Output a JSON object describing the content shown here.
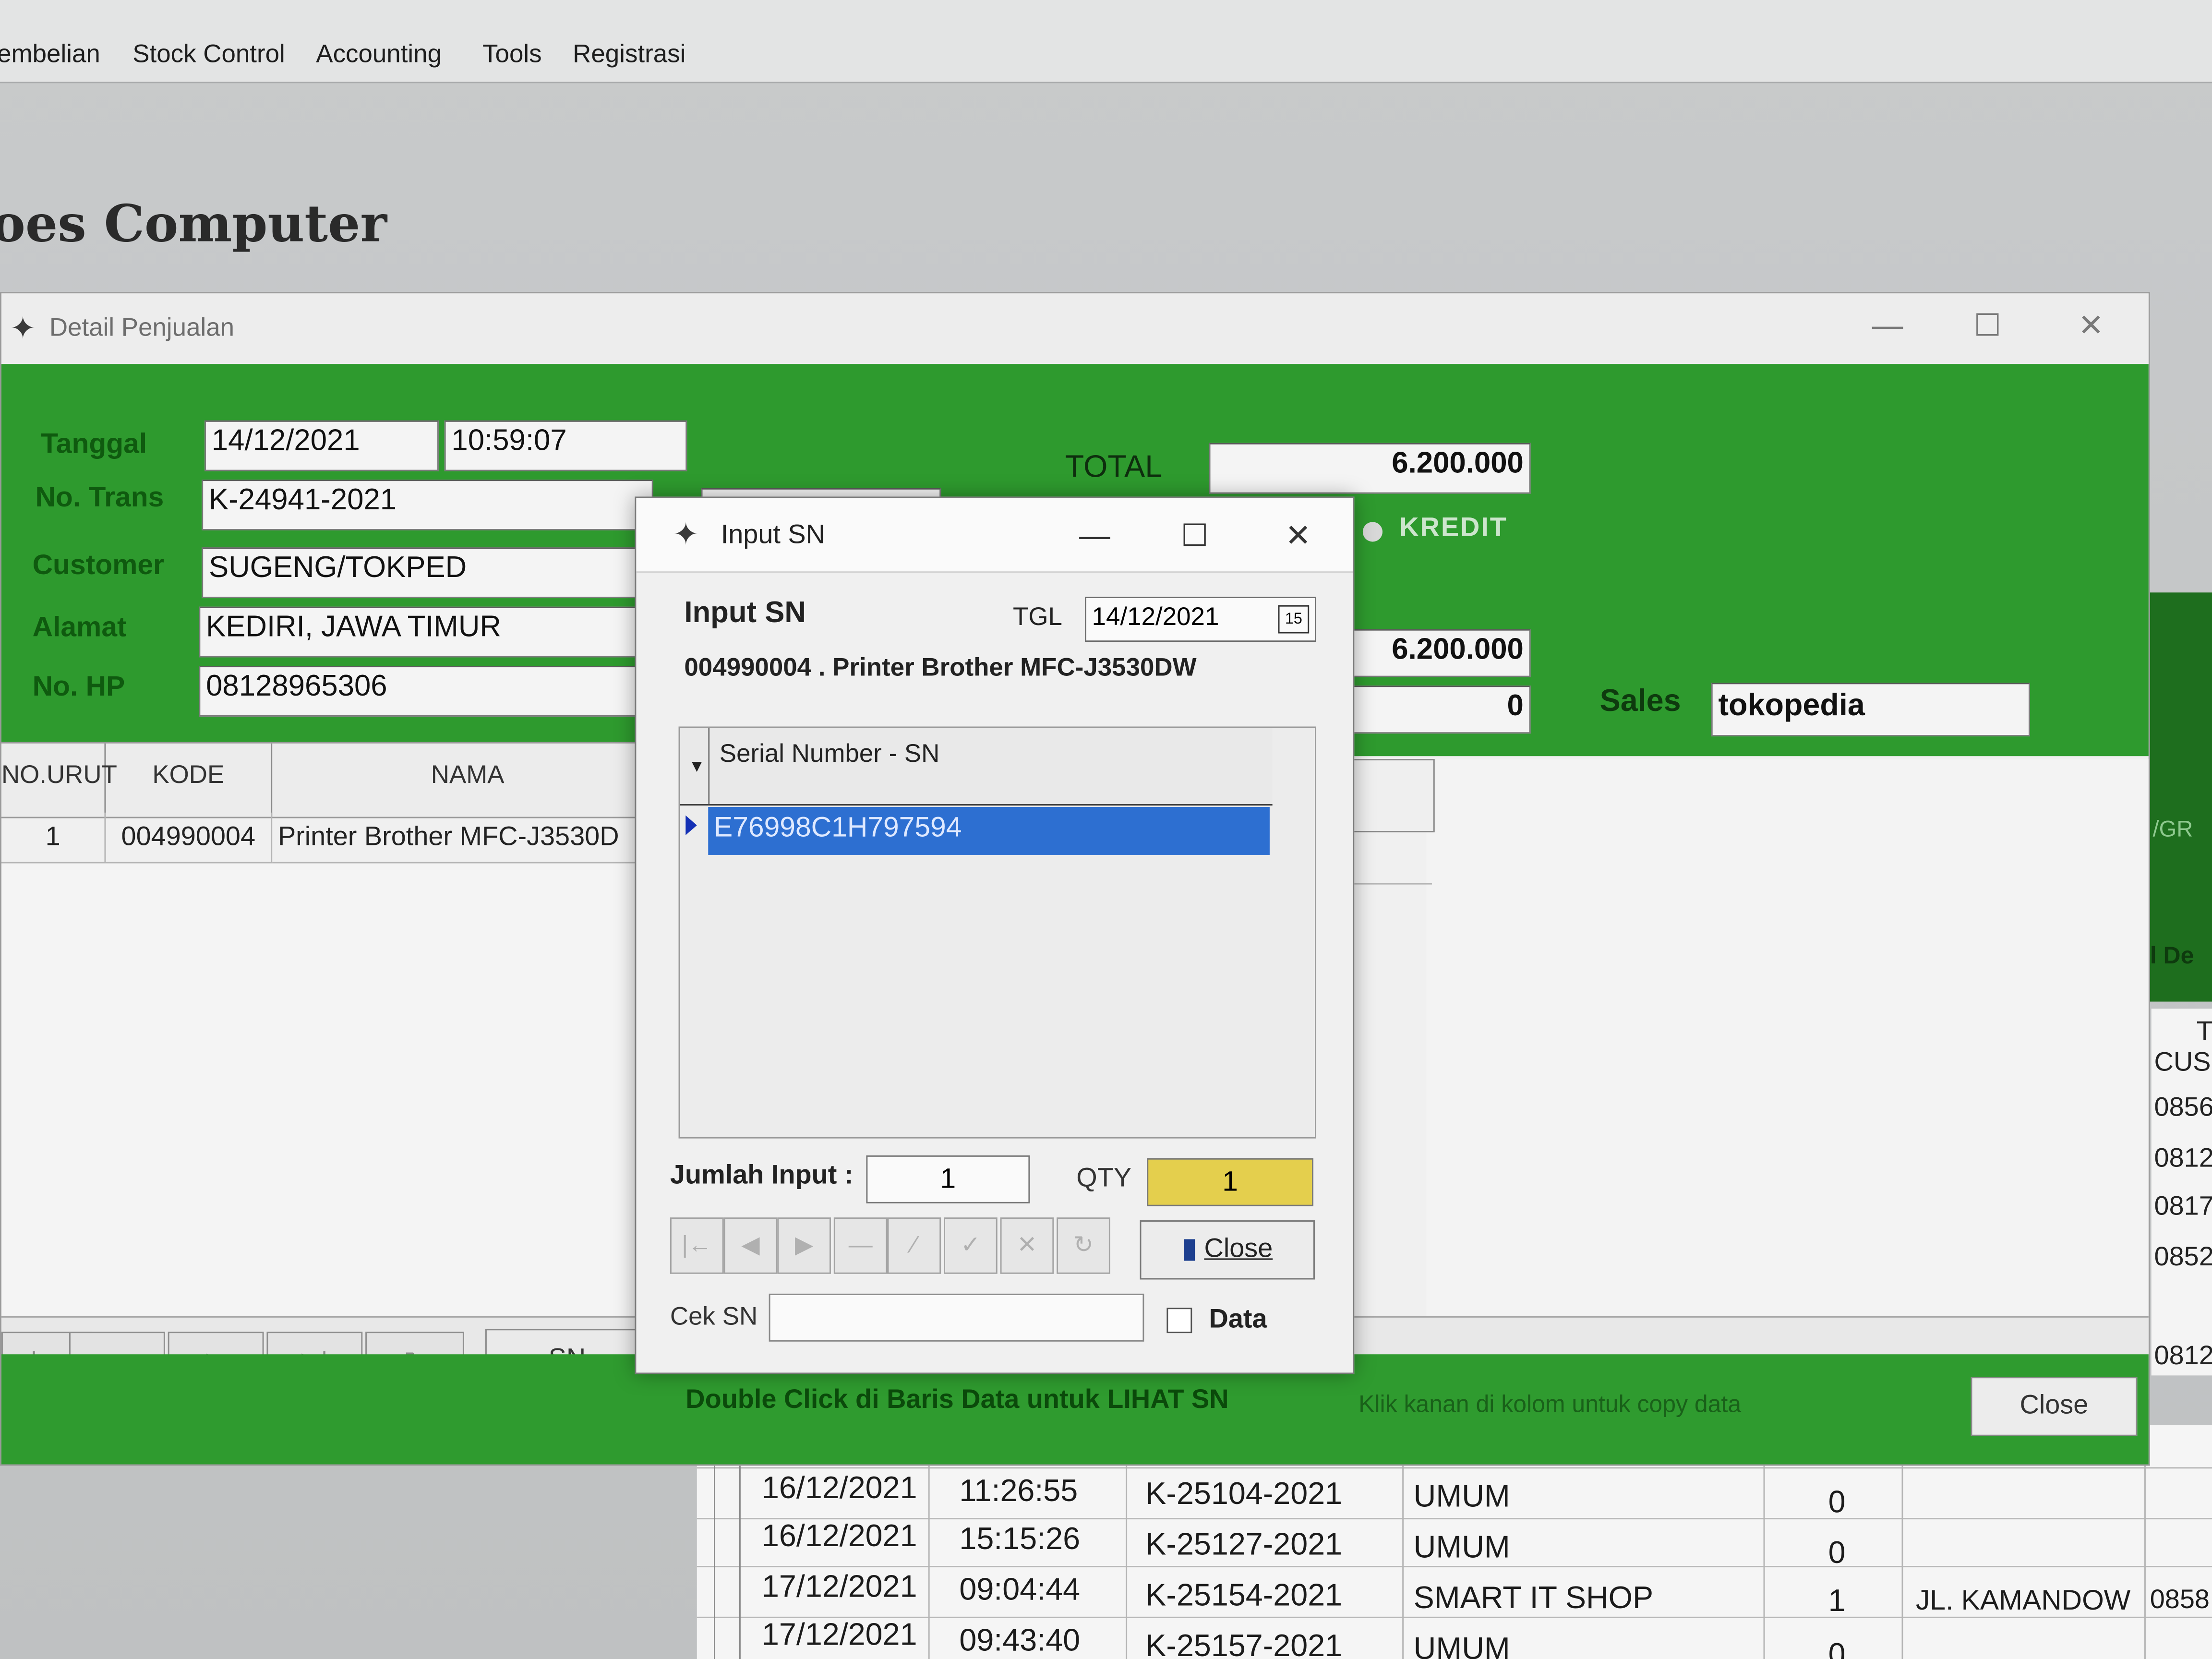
{
  "menu": [
    "embelian",
    "Stock Control",
    "Accounting",
    "Tools",
    "Registrasi"
  ],
  "app_title": "oes Computer",
  "detail_window": {
    "title": "Detail Penjualan",
    "labels": {
      "tanggal": "Tanggal",
      "no_trans": "No. Trans",
      "customer": "Customer",
      "alamat": "Alamat",
      "no_hp": "No. HP",
      "total": "TOTAL",
      "kredit": "KREDIT",
      "sales": "Sales"
    },
    "values": {
      "tanggal_date": "14/12/2021",
      "tanggal_time": "10:59:07",
      "no_trans": "K-24941-2021",
      "customer": "SUGENG/TOKPED",
      "alamat": "KEDIRI, JAWA TIMUR",
      "no_hp": "08128965306",
      "total": "6.200.000",
      "subtotal": "6.200.000",
      "discount": "0",
      "sales": "tokopedia"
    },
    "grid_headers": [
      "NO.URUT",
      "KODE",
      "NAMA"
    ],
    "grid_rows": [
      {
        "no": "1",
        "kode": "004990004",
        "nama": "Printer Brother MFC-J3530D"
      }
    ],
    "sn_button": "SN",
    "status_message": "Double Click di Baris Data untuk LIHAT SN",
    "status_hint": "Klik kanan di kolom untuk copy data",
    "close_button": "Close"
  },
  "sn_dialog": {
    "title": "Input SN",
    "heading": "Input SN",
    "tgl_label": "TGL",
    "tgl_value": "14/12/2021",
    "calendar_day": "15",
    "product": "004990004 . Printer Brother MFC-J3530DW",
    "column_header": "Serial Number - SN",
    "serial_numbers": [
      "E76998C1H797594"
    ],
    "jumlah_label": "Jumlah Input :",
    "jumlah_value": "1",
    "qty_label": "QTY",
    "qty_value": "1",
    "close_label": "Close",
    "cek_label": "Cek SN",
    "data_label": "Data"
  },
  "bottom_table": [
    {
      "date": "16/12/2021",
      "time": "11:26:55",
      "trans": "K-25104-2021",
      "cust": "UMUM",
      "n": "0",
      "addr": ""
    },
    {
      "date": "16/12/2021",
      "time": "15:15:26",
      "trans": "K-25127-2021",
      "cust": "UMUM",
      "n": "0",
      "addr": ""
    },
    {
      "date": "17/12/2021",
      "time": "09:04:44",
      "trans": "K-25154-2021",
      "cust": "SMART IT SHOP",
      "n": "1",
      "addr": "JL. KAMANDOW"
    },
    {
      "date": "17/12/2021",
      "time": "09:43:40",
      "trans": "K-25157-2021",
      "cust": "UMUM",
      "n": "0",
      "addr": ""
    }
  ],
  "right_col": {
    "header_t": "T",
    "header_cust": "CUS",
    "values": [
      "0856",
      "0812",
      "0817",
      "0852",
      "0812"
    ],
    "bottom_value": "0858",
    "side_labels": [
      "/GR",
      "l De"
    ]
  },
  "colors": {
    "green": "#2e9a2e",
    "selection": "#2d6fd1",
    "qty_yellow": "#e4cf4d"
  }
}
